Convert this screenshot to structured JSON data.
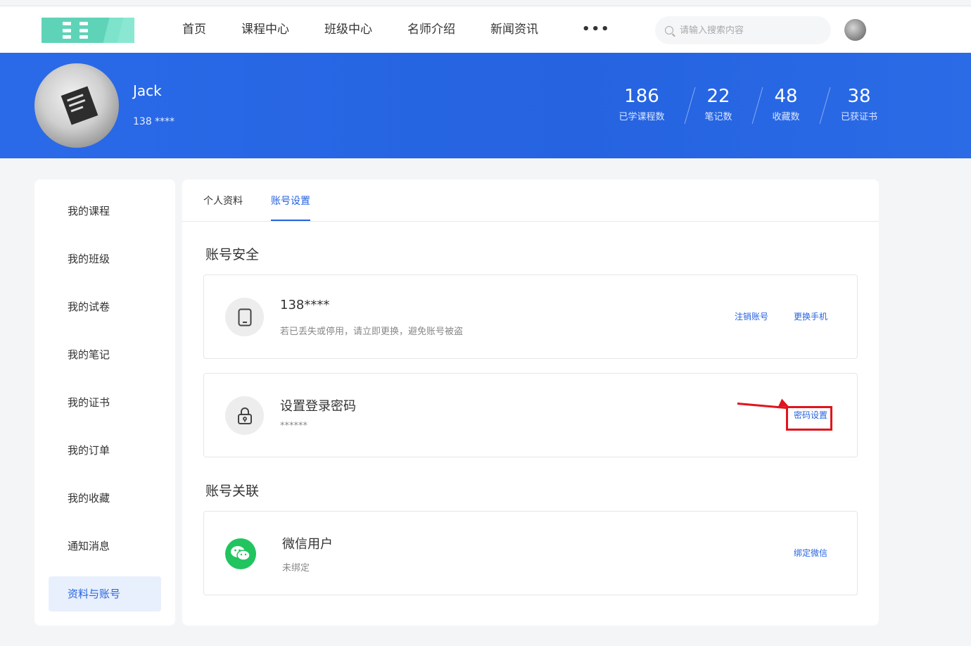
{
  "nav": {
    "items": [
      "首页",
      "课程中心",
      "班级中心",
      "名师介绍",
      "新闻资讯"
    ],
    "more": "•••",
    "search_placeholder": "请输入搜索内容"
  },
  "profile": {
    "name": "Jack",
    "phone": "138 ****",
    "stats": [
      {
        "value": "186",
        "label": "已学课程数"
      },
      {
        "value": "22",
        "label": "笔记数"
      },
      {
        "value": "48",
        "label": "收藏数"
      },
      {
        "value": "38",
        "label": "已获证书"
      }
    ]
  },
  "sidebar": {
    "items": [
      {
        "label": "我的课程"
      },
      {
        "label": "我的班级"
      },
      {
        "label": "我的试卷"
      },
      {
        "label": "我的笔记"
      },
      {
        "label": "我的证书"
      },
      {
        "label": "我的订单"
      },
      {
        "label": "我的收藏"
      },
      {
        "label": "通知消息"
      },
      {
        "label": "资料与账号"
      }
    ],
    "active_index": 8
  },
  "tabs": [
    "个人资料",
    "账号设置"
  ],
  "security": {
    "title": "账号安全",
    "phone_card": {
      "title": "138****",
      "sub": "若已丢失或停用，请立即更换，避免账号被盗",
      "link1": "注销账号",
      "link2": "更换手机"
    },
    "password_card": {
      "title": "设置登录密码",
      "sub": "******",
      "link": "密码设置"
    }
  },
  "linked": {
    "title": "账号关联",
    "wechat_card": {
      "title": "微信用户",
      "sub": "未绑定",
      "link": "绑定微信"
    }
  },
  "colors": {
    "primary": "#2563e0",
    "banner": "#2a6ae8",
    "wechat_green": "#21c45f",
    "annotation_red": "#e0151d"
  }
}
